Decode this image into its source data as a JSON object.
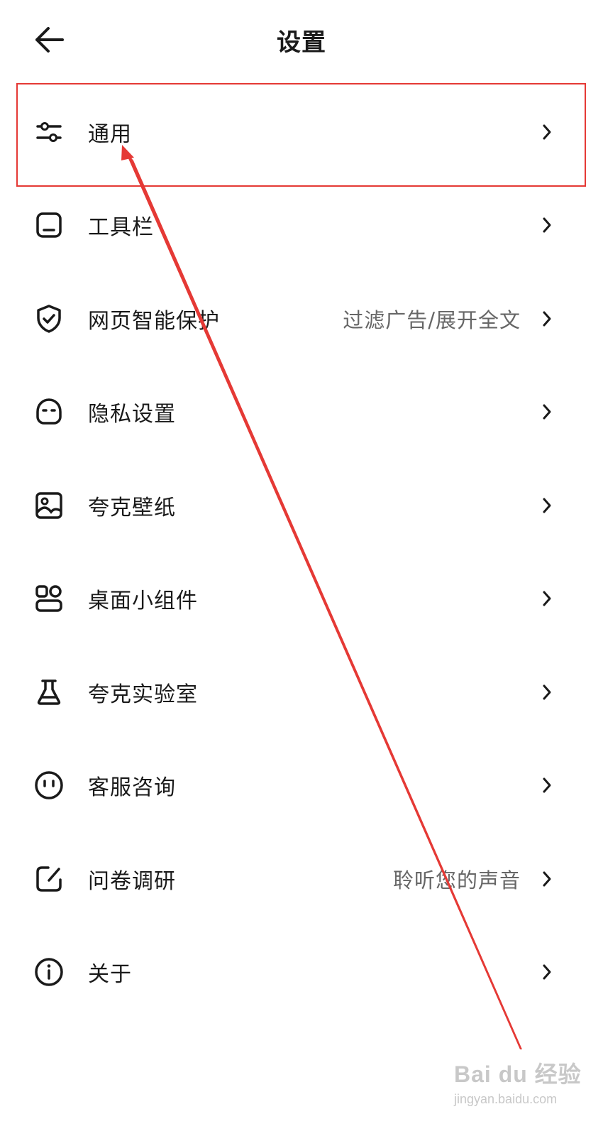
{
  "header": {
    "title": "设置",
    "back_icon": "arrow-left-icon"
  },
  "settings_items": [
    {
      "label": "通用",
      "subtitle": "",
      "icon": "sliders-icon"
    },
    {
      "label": "工具栏",
      "subtitle": "",
      "icon": "toolbar-icon"
    },
    {
      "label": "网页智能保护",
      "subtitle": "过滤广告/展开全文",
      "icon": "shield-check-icon"
    },
    {
      "label": "隐私设置",
      "subtitle": "",
      "icon": "privacy-face-icon"
    },
    {
      "label": "夸克壁纸",
      "subtitle": "",
      "icon": "wallpaper-image-icon"
    },
    {
      "label": "桌面小组件",
      "subtitle": "",
      "icon": "widgets-icon"
    },
    {
      "label": "夸克实验室",
      "subtitle": "",
      "icon": "flask-icon"
    },
    {
      "label": "客服咨询",
      "subtitle": "",
      "icon": "smiley-face-icon"
    },
    {
      "label": "问卷调研",
      "subtitle": "聆听您的声音",
      "icon": "edit-square-icon"
    },
    {
      "label": "关于",
      "subtitle": "",
      "icon": "info-circle-icon"
    }
  ],
  "annotation": {
    "color": "#e53935",
    "highlighted_item": "通用"
  },
  "watermark": {
    "logo": "Bai du 经验",
    "url": "jingyan.baidu.com"
  },
  "colors": {
    "text_primary": "#1a1a1a",
    "text_secondary": "#666666",
    "background": "#ffffff"
  }
}
